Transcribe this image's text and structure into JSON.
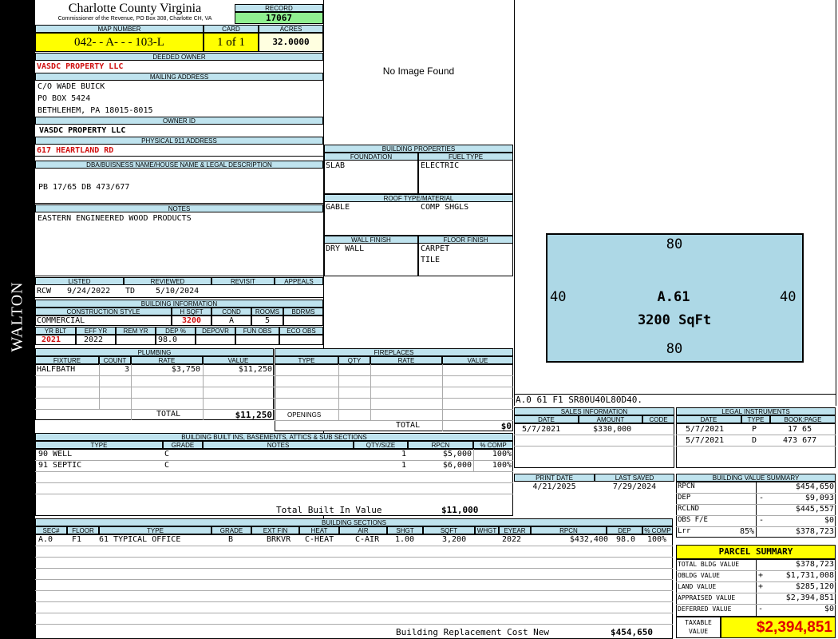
{
  "side_label": "WALTON",
  "county": {
    "title": "Charlotte County Virginia",
    "subtitle": "Commissioner of the Revenue, PO Box 308, Charlotte CH, VA"
  },
  "record": {
    "label": "RECORD",
    "value": "17067"
  },
  "map": {
    "label": "MAP NUMBER",
    "value": "042- - A- - - 103-L"
  },
  "card": {
    "label": "CARD",
    "value": "1 of 1"
  },
  "acres": {
    "label": "ACRES",
    "value": "32.0000"
  },
  "owner": {
    "label": "DEEDED OWNER",
    "value": "VASDC PROPERTY LLC"
  },
  "mailing": {
    "label": "MAILING ADDRESS",
    "line1": "C/O WADE BUICK",
    "line2": "PO BOX 5424",
    "line3": "BETHLEHEM, PA 18015-8015"
  },
  "owner_id": {
    "label": "OWNER ID",
    "value": "VASDC PROPERTY LLC"
  },
  "physical": {
    "label": "PHYSICAL 911 ADDRESS",
    "value": "617 HEARTLAND RD"
  },
  "legal": {
    "label": "DBA/BUISNESS NAME/HOUSE NAME & LEGAL DESCRIPTION",
    "value": "PB 17/65 DB 473/677"
  },
  "notes": {
    "label": "NOTES",
    "value": "EASTERN ENGINEERED WOOD PRODUCTS"
  },
  "image_placeholder": "No Image Found",
  "building_properties": {
    "label": "BUILDING PROPERTIES",
    "foundation_label": "FOUNDATION",
    "foundation": "SLAB",
    "fuel_label": "FUEL TYPE",
    "fuel": "ELECTRIC",
    "roof_label": "ROOF TYPE/MATERIAL",
    "roof_type": "GABLE",
    "roof_material": "COMP SHGLS",
    "wall_label": "WALL FINISH",
    "wall": "DRY WALL",
    "floor_label": "FLOOR FINISH",
    "floor1": "CARPET",
    "floor2": "TILE"
  },
  "sketch": {
    "top": "80",
    "bottom": "80",
    "left": "40",
    "right": "40",
    "area_code": "A.61",
    "sqft": "3200 SqFt",
    "footer": "A.0  61  F1  SR80U40L80D40."
  },
  "listing": {
    "listed_label": "LISTED",
    "reviewed_label": "REVIEWED",
    "revisit_label": "REVISIT",
    "appeals_label": "APPEALS",
    "listed_by": "RCW",
    "listed_date": "9/24/2022",
    "reviewed_by": "TD",
    "reviewed_date": "5/10/2024"
  },
  "building_info": {
    "label": "BUILDING INFORMATION",
    "style_label": "CONSTRUCTION STYLE",
    "hsqft_label": "H SQFT",
    "cond_label": "COND",
    "rooms_label": "ROOMS",
    "bdrms_label": "BDRMS",
    "style": "COMMERCIAL",
    "hsqft": "3200",
    "cond": "A",
    "rooms": "5",
    "yrblt_label": "YR BLT",
    "effyr_label": "EFF YR",
    "remyr_label": "REM YR",
    "dep_label": "DEP %",
    "depovr_label": "DEPOVR",
    "funobs_label": "FUN OBS",
    "ecoobs_label": "ECO OBS",
    "yrblt": "2021",
    "effyr": "2022",
    "dep": "98.0"
  },
  "plumbing": {
    "label": "PLUMBING",
    "cols": [
      "FIXTURE",
      "COUNT",
      "RATE",
      "VALUE"
    ],
    "rows": [
      {
        "fixture": "HALFBATH",
        "count": "3",
        "rate": "$3,750",
        "value": "$11,250"
      }
    ],
    "total_label": "TOTAL",
    "total": "$11,250"
  },
  "fireplaces": {
    "label": "FIREPLACES",
    "cols": [
      "TYPE",
      "QTY",
      "RATE",
      "VALUE"
    ],
    "openings_label": "OPENINGS",
    "total_label": "TOTAL",
    "total": "$0"
  },
  "built_ins": {
    "label": "BUILDING BUILT INS, BASEMENTS, ATTICS & SUB SECTIONS",
    "cols": [
      "TYPE",
      "GRADE",
      "NOTES",
      "QTY/SIZE",
      "RPCN",
      "% COMP"
    ],
    "rows": [
      {
        "type": "90 WELL",
        "grade": "C",
        "qty": "1",
        "rpcn": "$5,000",
        "comp": "100%"
      },
      {
        "type": "91 SEPTIC",
        "grade": "C",
        "qty": "1",
        "rpcn": "$6,000",
        "comp": "100%"
      }
    ],
    "total_label": "Total Built In Value",
    "total": "$11,000"
  },
  "sales": {
    "label": "SALES INFORMATION",
    "cols": [
      "DATE",
      "AMOUNT",
      "CODE"
    ],
    "rows": [
      {
        "date": "5/7/2021",
        "amount": "$330,000",
        "code": ""
      }
    ]
  },
  "legal_instruments": {
    "label": "LEGAL INSTRUMENTS",
    "cols": [
      "DATE",
      "TYPE",
      "BOOK:PAGE"
    ],
    "rows": [
      {
        "date": "5/7/2021",
        "type": "P",
        "bookpage": "17 65"
      },
      {
        "date": "5/7/2021",
        "type": "D",
        "bookpage": "473 677"
      }
    ]
  },
  "print": {
    "print_label": "PRINT DATE",
    "print_date": "4/21/2025",
    "saved_label": "LAST SAVED",
    "saved_date": "7/29/2024"
  },
  "value_summary": {
    "label": "BUILDING VALUE SUMMARY",
    "rows": [
      {
        "label": "RPCN",
        "sign": "",
        "pct": "",
        "value": "$454,650"
      },
      {
        "label": "DEP",
        "sign": "-",
        "pct": "",
        "value": "$9,093"
      },
      {
        "label": "RCLND",
        "sign": "",
        "pct": "",
        "value": "$445,557"
      },
      {
        "label": "OBS F/E",
        "sign": "-",
        "pct": "",
        "value": "$0"
      },
      {
        "label": "Lrr",
        "sign": "",
        "pct": "85%",
        "value": "$378,723"
      }
    ]
  },
  "parcel_summary": {
    "label": "PARCEL SUMMARY",
    "rows": [
      {
        "label": "TOTAL BLDG VALUE",
        "sign": "",
        "value": "$378,723"
      },
      {
        "label": "OBLDG VALUE",
        "sign": "+",
        "value": "$1,731,008"
      },
      {
        "label": "LAND VALUE",
        "sign": "+",
        "value": "$285,120"
      },
      {
        "label": "APPRAISED VALUE",
        "sign": "",
        "value": "$2,394,851"
      },
      {
        "label": "DEFERRED VALUE",
        "sign": "-",
        "value": "$0"
      }
    ],
    "taxable_label_1": "TAXABLE",
    "taxable_label_2": "VALUE",
    "taxable": "$2,394,851"
  },
  "sections": {
    "label": "BUILDING SECTIONS",
    "cols": [
      "SEC#",
      "FLOOR",
      "TYPE",
      "GRADE",
      "EXT FIN",
      "HEAT",
      "AIR",
      "SHGT",
      "SQFT",
      "WHGT",
      "EYEAR",
      "RPCN",
      "DEP",
      "% COMP"
    ],
    "rows": [
      {
        "sec": "A.0",
        "floor": "F1",
        "type": "61 TYPICAL OFFICE",
        "grade": "B",
        "ext": "BRKVR",
        "heat": "C-HEAT",
        "air": "C-AIR",
        "shgt": "1.00",
        "sqft": "3,200",
        "whgt": "",
        "eyear": "2022",
        "rpcn": "$432,400",
        "dep": "98.0",
        "comp": "100%"
      }
    ],
    "total_label": "Building Replacement Cost New",
    "total": "$454,650"
  }
}
